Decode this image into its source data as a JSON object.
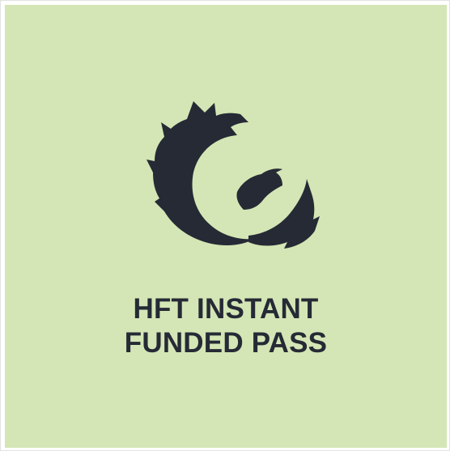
{
  "colors": {
    "background": "#d4e6b5",
    "ink": "#262a35",
    "border": "#e2e2e2"
  },
  "logo": {
    "icon": "phoenix-icon"
  },
  "caption": {
    "line1": "HFT INSTANT",
    "line2": "FUNDED PASS"
  }
}
